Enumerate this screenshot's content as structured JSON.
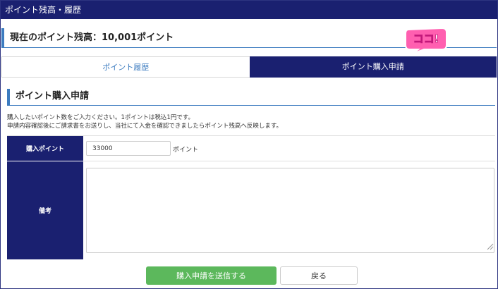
{
  "header": {
    "title": "ポイント残高・履歴"
  },
  "balance": {
    "text": "現在のポイント残高：10,001ポイント"
  },
  "badge": {
    "text": "ココ!",
    "color": "#ff5fb0"
  },
  "tabs": [
    {
      "label": "ポイント履歴",
      "active": false
    },
    {
      "label": "ポイント購入申請",
      "active": true
    }
  ],
  "section": {
    "title": "ポイント購入申請"
  },
  "description": {
    "line1": "購入したいポイント数をご入力ください。1ポイントは税込1円です。",
    "line2": "申請内容確認後にご請求書をお送りし、当社にて入金を確認できましたらポイント残高へ反映します。"
  },
  "form": {
    "points_label": "購入ポイント",
    "points_value": "33000",
    "points_unit": "ポイント",
    "notes_label": "備考",
    "notes_value": ""
  },
  "buttons": {
    "submit": "購入申請を送信する",
    "back": "戻る"
  },
  "colors": {
    "navy": "#1a2070",
    "accent_blue": "#3d7cc0",
    "submit_green": "#5cb85c"
  }
}
